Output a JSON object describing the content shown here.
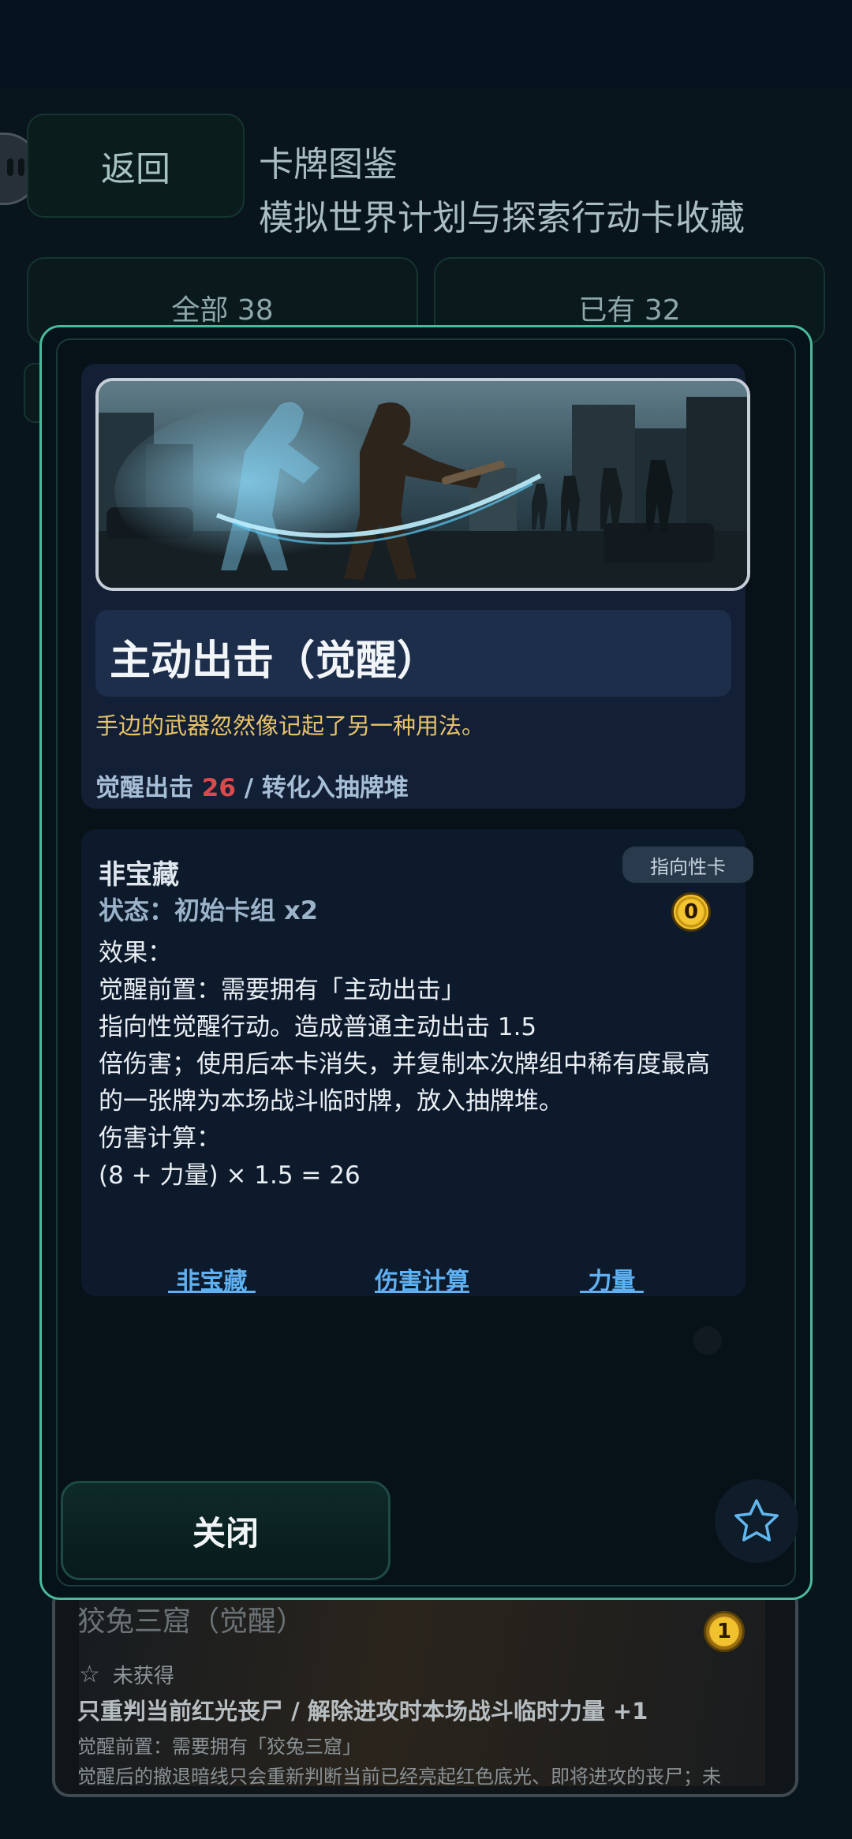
{
  "header": {
    "back_label": "返回",
    "title": "卡牌图鉴",
    "subtitle": "模拟世界计划与探索行动卡收藏"
  },
  "filters": {
    "all_label": "全部 38",
    "owned_label": "已有 32"
  },
  "modal": {
    "card": {
      "name": "主动出击（觉醒）",
      "flavor": "手边的武器忽然像记起了另一种用法。",
      "summary_prefix": "觉醒出击",
      "summary_value": "26",
      "summary_suffix": "/ 转化入抽牌堆"
    },
    "info": {
      "rarity": "非宝藏",
      "status": "状态：初始卡组 x2",
      "type_badge": "指向性卡",
      "cost": "0",
      "effect_lines": [
        "效果：",
        "觉醒前置：需要拥有「主动出击」",
        "指向性觉醒行动。造成普通主动出击 1.5",
        "倍伤害；使用后本卡消失，并复制本次牌组中稀有度最高",
        "的一张牌为本场战斗临时牌，放入抽牌堆。",
        "伤害计算：",
        "(8 + 力量) × 1.5 = 26"
      ],
      "links": [
        " 非宝藏 ",
        "伤害计算",
        " 力量 "
      ]
    },
    "close_label": "关闭",
    "favorite_icon": "star-outline-icon",
    "border_color": "#4bb99c"
  },
  "background_card": {
    "title": "狡兔三窟（觉醒）",
    "cost": "1",
    "status": "未获得",
    "effect": "只重判当前红光丧尸 / 解除进攻时本场战斗临时力量 +1",
    "prerequisite": "觉醒前置：需要拥有「狡兔三窟」",
    "description": "觉醒后的撤退暗线只会重新判断当前已经亮起红色底光、即将进攻的丧尸；未"
  }
}
